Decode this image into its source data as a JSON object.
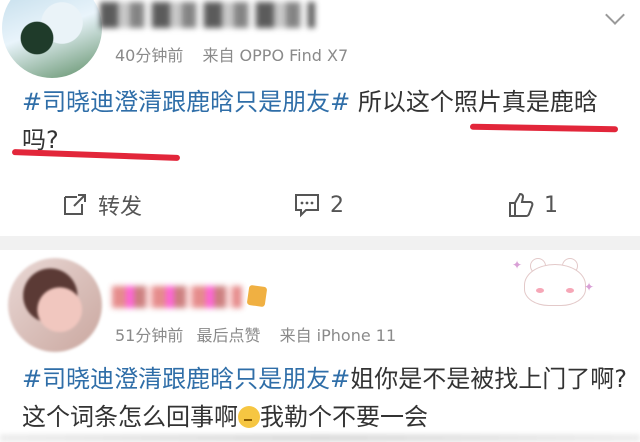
{
  "posts": [
    {
      "meta": {
        "time": "40分钟前",
        "source": "来自 OPPO Find X7"
      },
      "content": {
        "topic": "#司晓迪澄清跟鹿晗只是朋友#",
        "text": " 所以这个照片真是鹿晗吗?"
      },
      "actions": {
        "repost_label": "转发",
        "comment_count": "2",
        "like_count": "1"
      }
    },
    {
      "meta": {
        "time": "51分钟前",
        "last_liked": "最后点赞",
        "source": "来自 iPhone 11"
      },
      "content": {
        "topic": "#司晓迪澄清跟鹿晗只是朋友#",
        "text": "姐你是不是被找上门了啊? 这个词条怎么回事啊",
        "text_after_emoji": "我勒个不要一会"
      }
    }
  ],
  "colors": {
    "topic": "#2f6ea8",
    "annotation": "#e2263a",
    "meta": "#8a8a8a",
    "divider": "#f1f1f1"
  },
  "icons": [
    "chevron-down-icon",
    "repost-icon",
    "comment-icon",
    "like-icon",
    "thinking-emoji"
  ]
}
